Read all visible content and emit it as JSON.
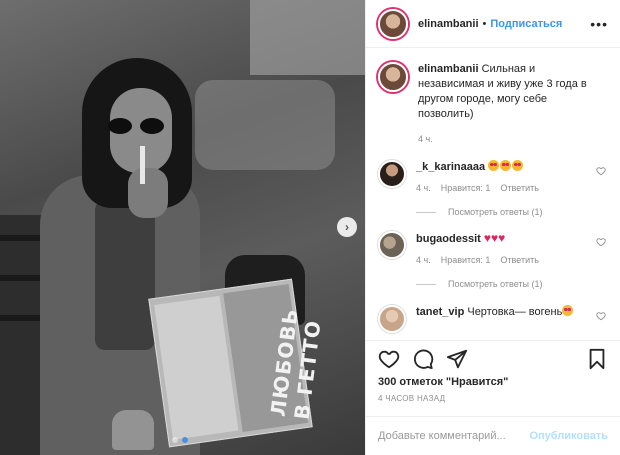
{
  "post": {
    "author": "elinambanii",
    "follow_label": "Подписаться",
    "separator": "•",
    "more_label": "•••",
    "caption": "Сильная и независимая и живу уже 3 года в другом городе, могу себе позволить)",
    "caption_time": "4 ч."
  },
  "photo": {
    "magazine_title": "ЛЮБОВЬ В ГЕТТО",
    "next_label": "›",
    "carousel_total": 2,
    "carousel_active": 2
  },
  "comments": [
    {
      "user": "_k_karinaaaa",
      "text": "",
      "emoji": [
        "heart-eyes",
        "heart-eyes",
        "heart-eyes"
      ],
      "time": "4 ч.",
      "likes": "Нравится: 1",
      "reply": "Ответить",
      "view_replies": "Посмотреть ответы (1)"
    },
    {
      "user": "bugaodessit",
      "text": "",
      "emoji": [
        "red-heart",
        "red-heart",
        "red-heart"
      ],
      "time": "4 ч.",
      "likes": "Нравится: 1",
      "reply": "Ответить",
      "view_replies": "Посмотреть ответы (1)"
    },
    {
      "user": "tanet_vip",
      "text": "Чертовка— вогень",
      "emoji": [
        "heart-eyes"
      ]
    }
  ],
  "stats": {
    "likes": "300 отметок \"Нравится\"",
    "timestamp": "4 часов назад"
  },
  "composer": {
    "placeholder": "Добавьте комментарий...",
    "post_label": "Опубликовать"
  },
  "colors": {
    "link": "#3897f0",
    "text": "#262626",
    "muted": "#8e8e8e",
    "post_disabled": "#b2dffc",
    "heart": "#e0245e"
  }
}
